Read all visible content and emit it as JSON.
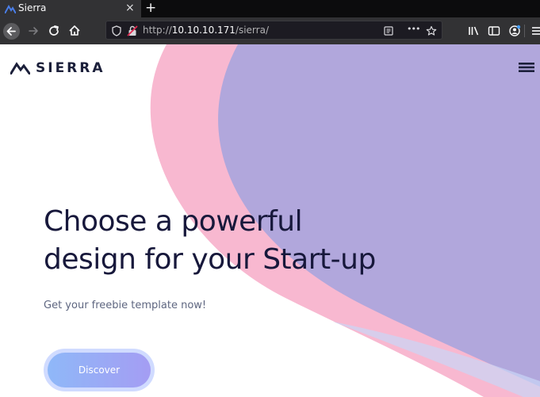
{
  "browser": {
    "tab_title": "Sierra",
    "tab_close": "×",
    "new_tab": "+",
    "url_prefix": "http://",
    "url_host": "10.10.10.171",
    "url_path": "/sierra/",
    "toolbar_icons": [
      "back-icon",
      "forward-icon",
      "reload-icon",
      "home-icon",
      "shield-icon",
      "insecure-lock-icon",
      "reader-view-icon",
      "more-icon",
      "bookmark-star-icon",
      "library-icon",
      "sidebar-icon",
      "account-icon",
      "menu-icon"
    ],
    "more_label": "•••"
  },
  "site": {
    "logo": "SIERRA",
    "headline_line1": "Choose a powerful",
    "headline_line2": "design for your Start-up",
    "subline": "Get your freebie template now!",
    "cta_label": "Discover"
  },
  "colors": {
    "pink_blob": "#f8b8d0",
    "purple_blob": "#b1a7dc",
    "blue_blob": "#a8c8f4",
    "text_dark": "#17183b",
    "chrome_dark": "#0c0c0d",
    "chrome_mid": "#323234"
  }
}
